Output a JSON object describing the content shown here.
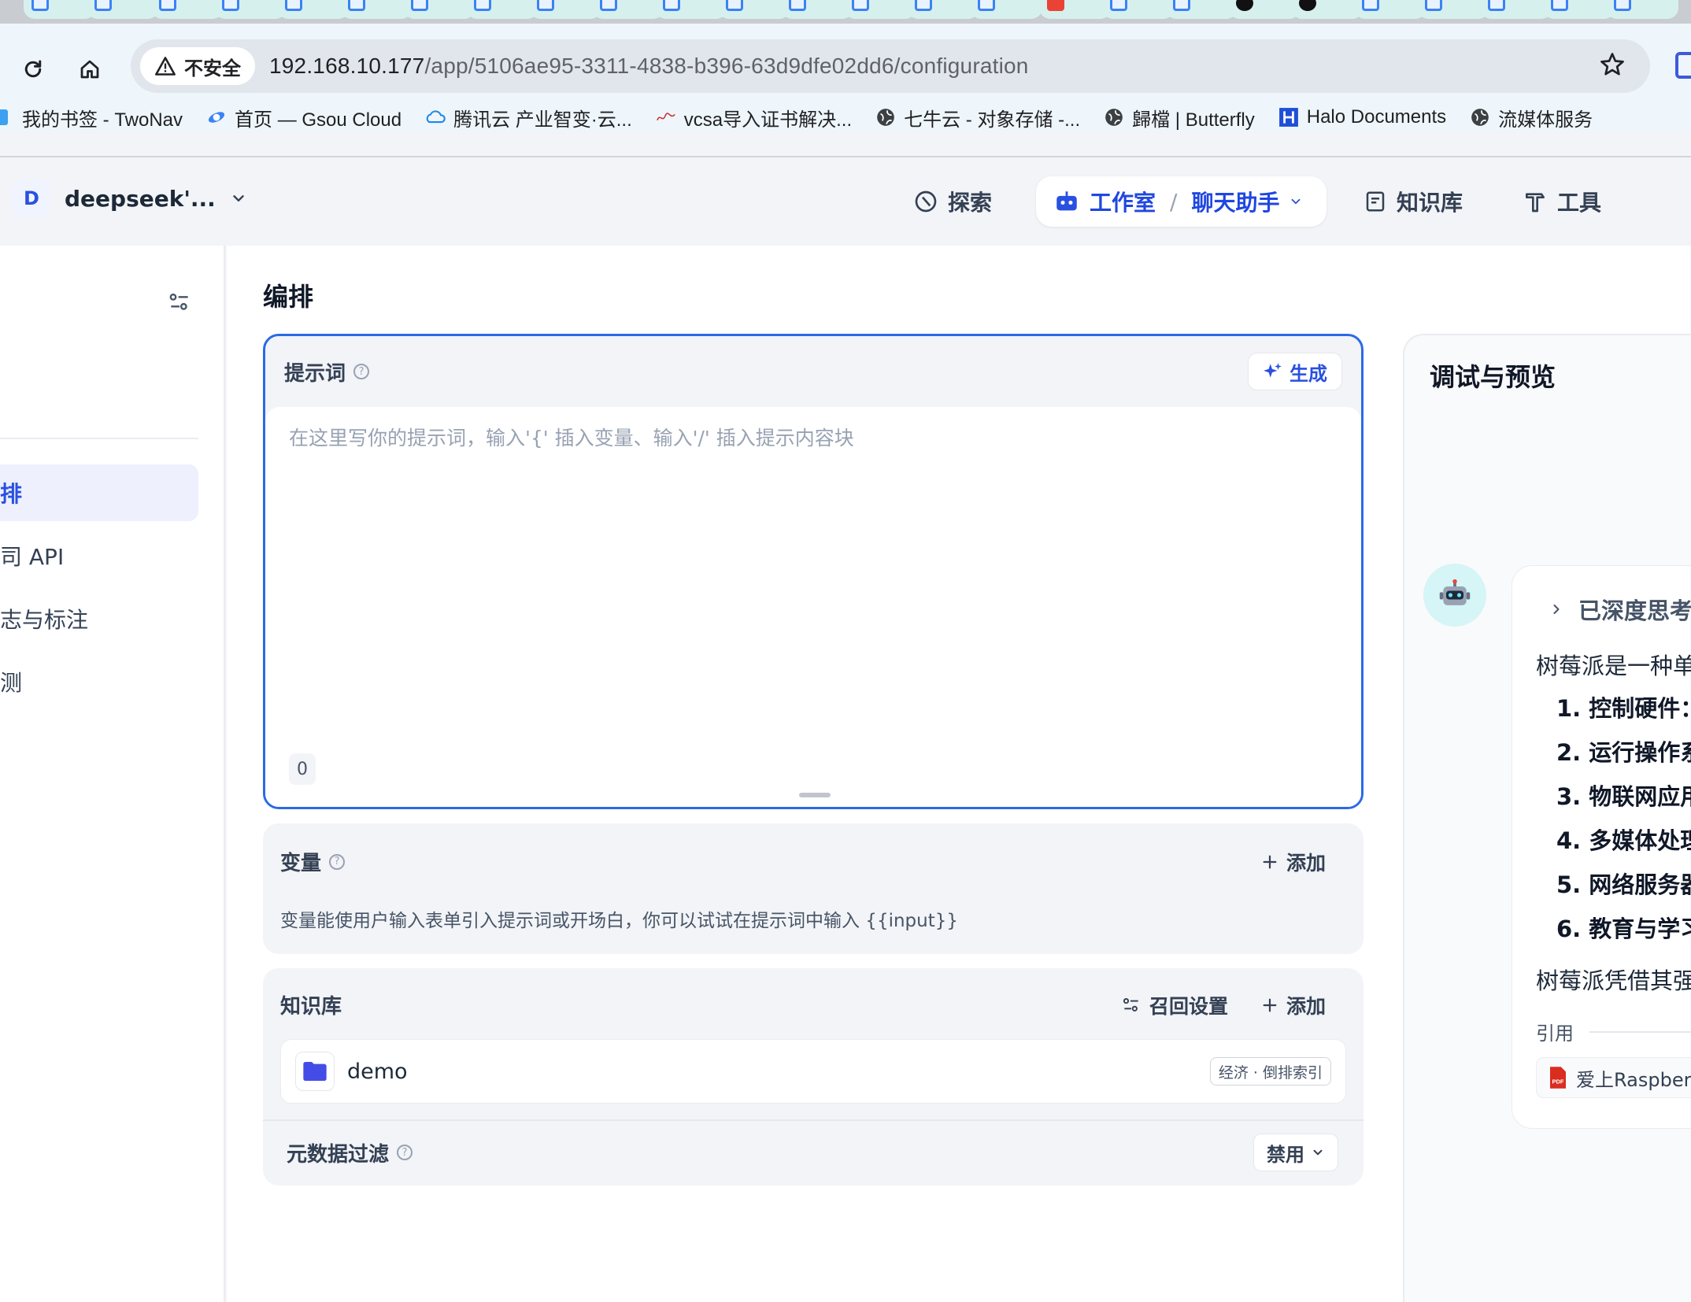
{
  "browser": {
    "security_label": "不安全",
    "url_host": "192.168.10.177",
    "url_path": "/app/5106ae95-3311-4838-b396-63d9dfe02dd6/configuration",
    "bookmarks": [
      {
        "label": "我的书签 - TwoNav",
        "icon": "square-icon"
      },
      {
        "label": "首页 — Gsou Cloud",
        "icon": "gsou-icon"
      },
      {
        "label": "腾讯云 产业智变·云...",
        "icon": "tencent-cloud-icon"
      },
      {
        "label": "vcsa导入证书解决...",
        "icon": "signature-icon"
      },
      {
        "label": "七牛云 - 对象存储 -...",
        "icon": "globe-icon"
      },
      {
        "label": "歸檔 | Butterfly",
        "icon": "globe-icon"
      },
      {
        "label": "Halo Documents",
        "icon": "halo-icon"
      },
      {
        "label": "流媒体服务",
        "icon": "globe-icon"
      }
    ]
  },
  "header": {
    "workspace_initial": "D",
    "workspace_name": "deepseek'...",
    "nav": {
      "explore": "探索",
      "studio": "工作室",
      "app_name": "聊天助手",
      "knowledge": "知识库",
      "tools": "工具"
    }
  },
  "sidebar": {
    "items": [
      "排",
      "司 API",
      "志与标注",
      "测"
    ]
  },
  "main": {
    "title": "编排",
    "prompt": {
      "title": "提示词",
      "generate_label": "生成",
      "placeholder": "在这里写你的提示词，输入'{' 插入变量、输入'/' 插入提示内容块",
      "char_count": "0"
    },
    "variables": {
      "title": "变量",
      "add_label": "添加",
      "description": "变量能使用户输入表单引入提示词或开场白，你可以试试在提示词中输入 {{input}}"
    },
    "knowledge": {
      "title": "知识库",
      "recall_label": "召回设置",
      "add_label": "添加",
      "item_name": "demo",
      "item_tag": "经济 · 倒排索引",
      "metadata_filter_label": "元数据过滤",
      "metadata_filter_value": "禁用"
    }
  },
  "preview": {
    "title": "调试与预览",
    "thinking_label": "已深度思考",
    "answer_intro": "树莓派是一种单",
    "list": [
      "1. 控制硬件：",
      "2. 运行操作系",
      "3. 物联网应用",
      "4. 多媒体处理",
      "5. 网络服务器",
      "6. 教育与学习"
    ],
    "answer_outro": "树莓派凭借其强",
    "citation_label": "引用",
    "citation_file": "爱上Raspberr"
  },
  "colors": {
    "accent": "#2950e0",
    "focus_border": "#2b6ae6"
  }
}
